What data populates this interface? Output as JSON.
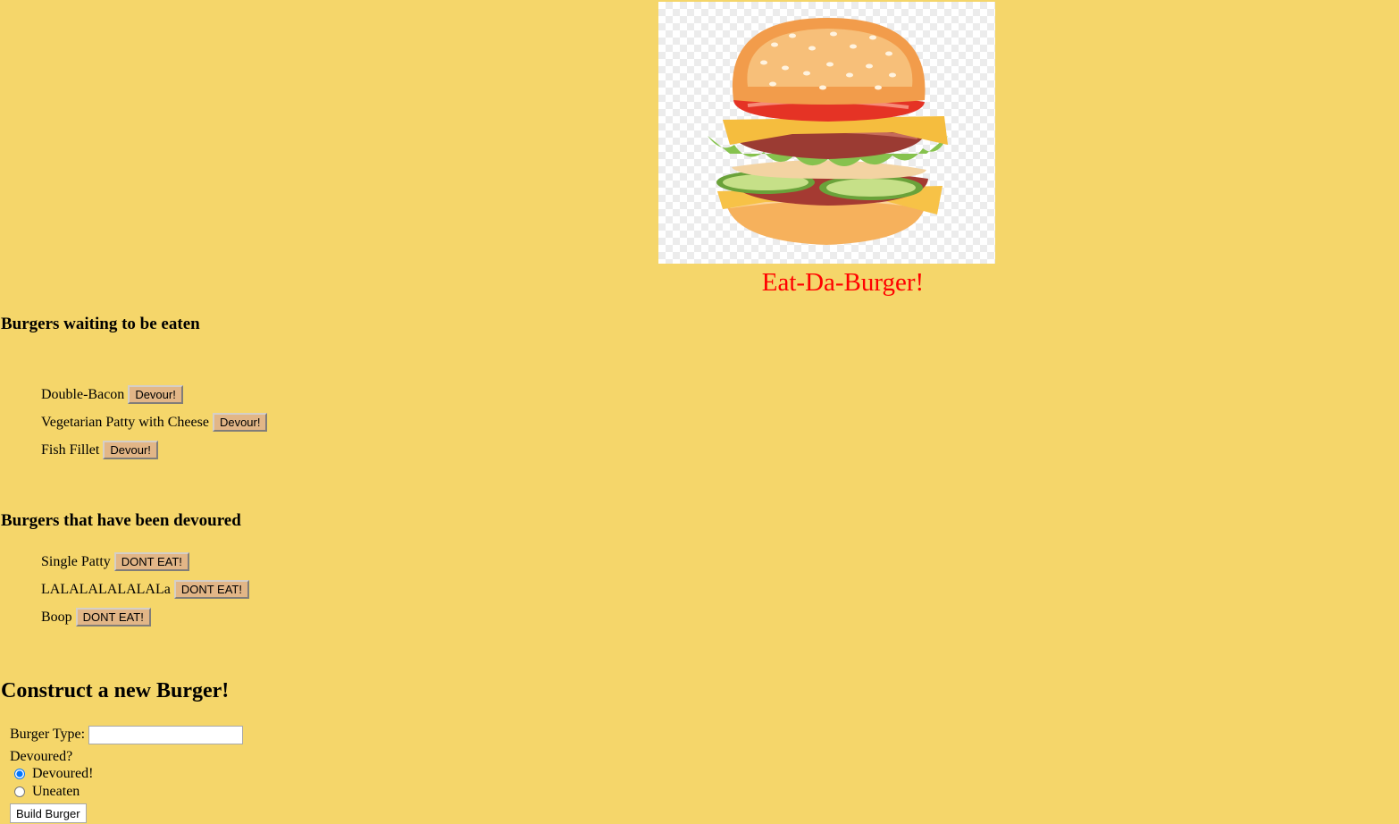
{
  "header": {
    "image_alt": "burger",
    "title": "Eat-Da-Burger!"
  },
  "uneaten": {
    "heading": "Burgers waiting to be eaten",
    "button_label": "Devour!",
    "items": [
      "Double-Bacon",
      "Vegetarian Patty with Cheese",
      "Fish Fillet"
    ]
  },
  "devoured": {
    "heading": "Burgers that have been devoured",
    "button_label": "DONT EAT!",
    "items": [
      "Single Patty",
      "LALALALALALALa",
      "Boop"
    ]
  },
  "form": {
    "heading": "Construct a new Burger!",
    "type_label": "Burger Type:",
    "type_value": "",
    "devoured_label": "Devoured?",
    "options": [
      "Devoured!",
      "Uneaten"
    ],
    "selected": "Devoured!",
    "submit_label": "Build Burger"
  },
  "colors": {
    "background": "#f5d66a",
    "title": "#ff0000",
    "button": "#e2b687"
  }
}
